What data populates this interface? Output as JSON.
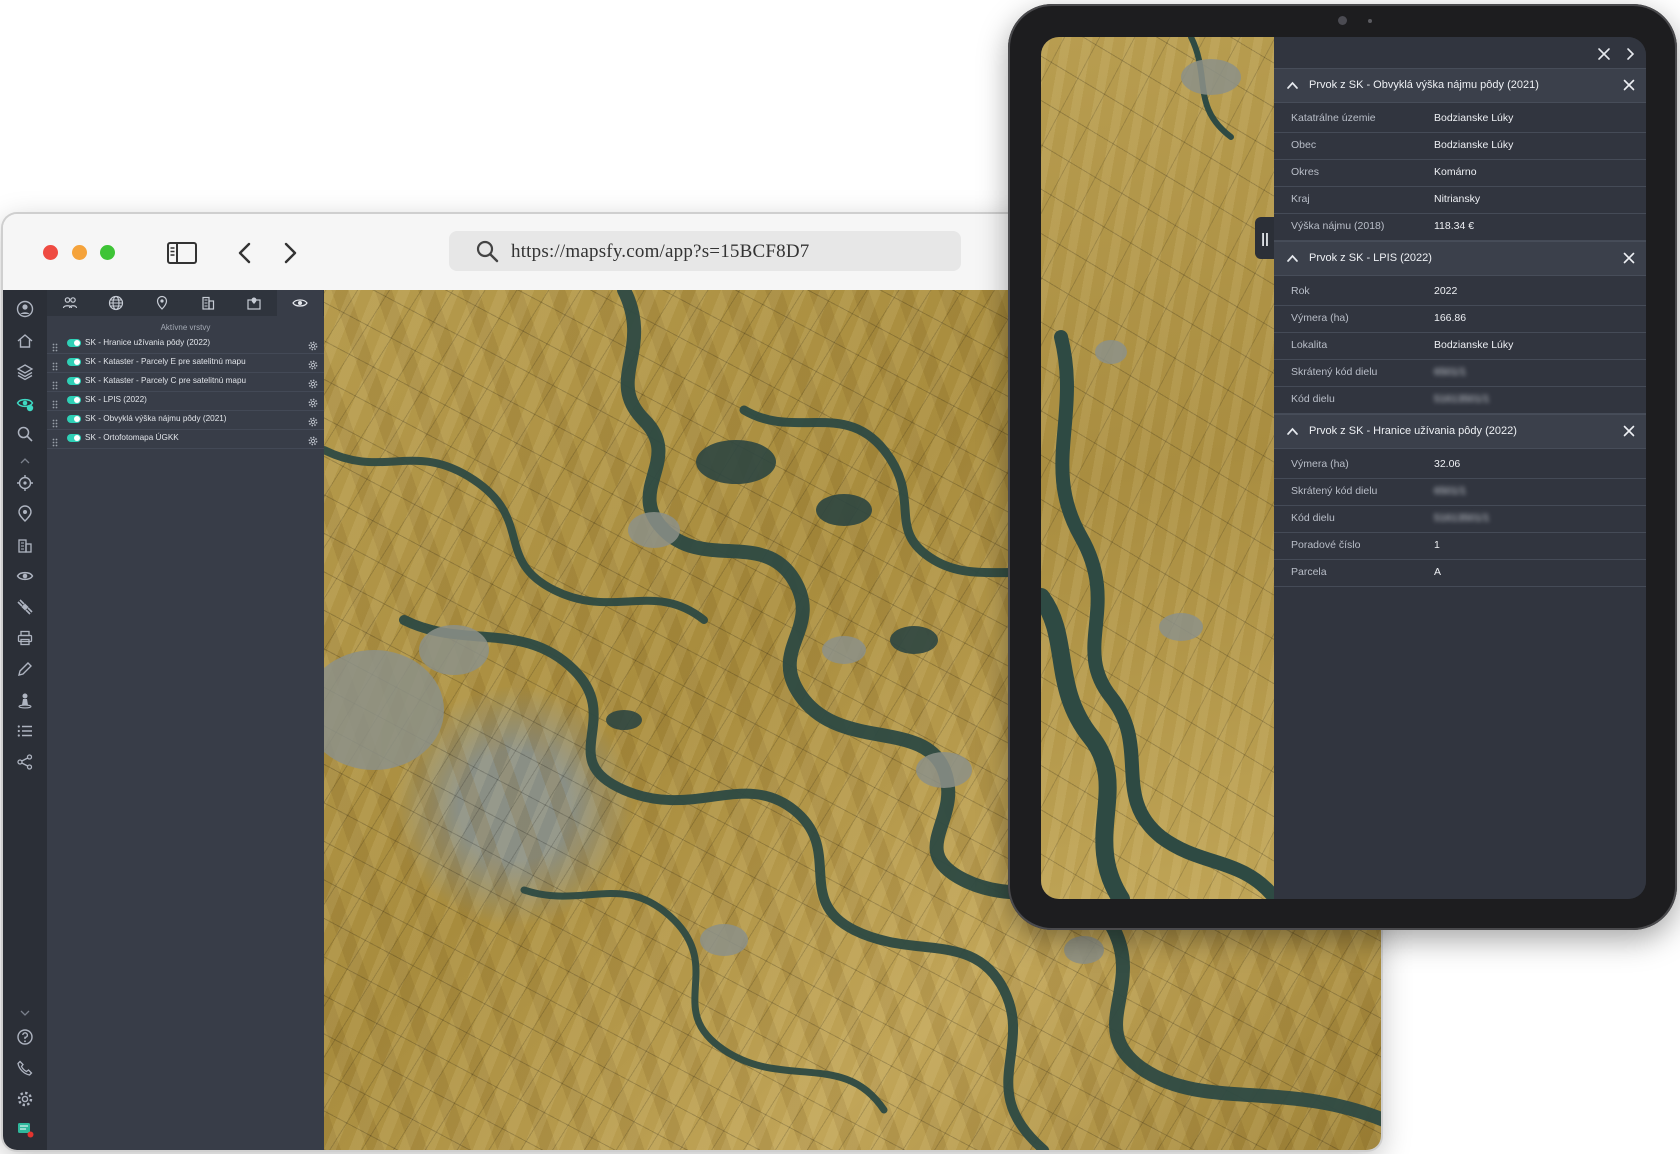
{
  "browser": {
    "url": "https://mapsfy.com/app?s=15BCF8D7"
  },
  "layers_panel": {
    "heading": "Aktívne vrstvy",
    "layers": [
      {
        "label": "SK - Hranice užívania pôdy (2022)"
      },
      {
        "label": "SK - Kataster - Parcely E pre satelitnú mapu"
      },
      {
        "label": "SK - Kataster - Parcely C pre satelitnú mapu"
      },
      {
        "label": "SK - LPIS (2022)"
      },
      {
        "label": "SK - Obvyklá výška nájmu pôdy (2021)"
      },
      {
        "label": "SK - Ortofotomapa ÚGKK"
      }
    ],
    "toggle_color": "#2fd0b6"
  },
  "info_panel": {
    "sections": [
      {
        "title": "Prvok z SK - Obvyklá výška nájmu pôdy (2021)",
        "rows": [
          {
            "key": "Katatrálne územie",
            "value": "Bodzianske Lúky"
          },
          {
            "key": "Obec",
            "value": "Bodzianske Lúky"
          },
          {
            "key": "Okres",
            "value": "Komárno"
          },
          {
            "key": "Kraj",
            "value": "Nitriansky"
          },
          {
            "key": "Výška nájmu (2018)",
            "value": "118.34 €"
          }
        ]
      },
      {
        "title": "Prvok z SK - LPIS (2022)",
        "rows": [
          {
            "key": "Rok",
            "value": "2022"
          },
          {
            "key": "Výmera (ha)",
            "value": "166.86"
          },
          {
            "key": "Lokalita",
            "value": "Bodzianske Lúky"
          },
          {
            "key": "Skrátený kód dielu",
            "value": "6501/1"
          },
          {
            "key": "Kód dielu",
            "value": "51613501/1"
          }
        ]
      },
      {
        "title": "Prvok z SK - Hranice užívania pôdy (2022)",
        "rows": [
          {
            "key": "Výmera (ha)",
            "value": "32.06"
          },
          {
            "key": "Skrátený kód dielu",
            "value": "6501/1"
          },
          {
            "key": "Kód dielu",
            "value": "51613501/1"
          },
          {
            "key": "Poradové číslo",
            "value": "1"
          },
          {
            "key": "Parcela",
            "value": "A"
          }
        ]
      }
    ]
  }
}
